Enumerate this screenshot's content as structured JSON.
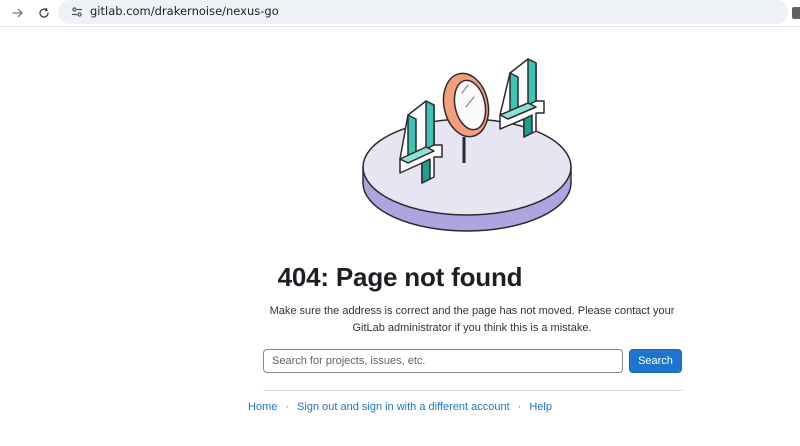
{
  "browser": {
    "url": "gitlab.com/drakernoise/nexus-go",
    "icons": [
      "forward-arrow-icon",
      "reload-icon",
      "site-settings-icon"
    ]
  },
  "illustration": {
    "digits": "404",
    "colors": {
      "teal": "#38c2b2",
      "teal_dark": "#1d9a8c",
      "lens_orange": "#f0a07c",
      "platform_top": "#e6e4f0",
      "platform_side": "#9d8fd6"
    }
  },
  "error": {
    "title": "404: Page not found",
    "description": "Make sure the address is correct and the page has not moved. Please contact your GitLab administrator if you think this is a mistake."
  },
  "search": {
    "placeholder": "Search for projects, issues, etc.",
    "value": "",
    "button_label": "Search"
  },
  "footer": {
    "links": [
      "Home",
      "Sign out and sign in with a different account",
      "Help"
    ],
    "separator": "·"
  },
  "colors": {
    "accent": "#1f75cb",
    "title_text": "#1f1e24"
  }
}
